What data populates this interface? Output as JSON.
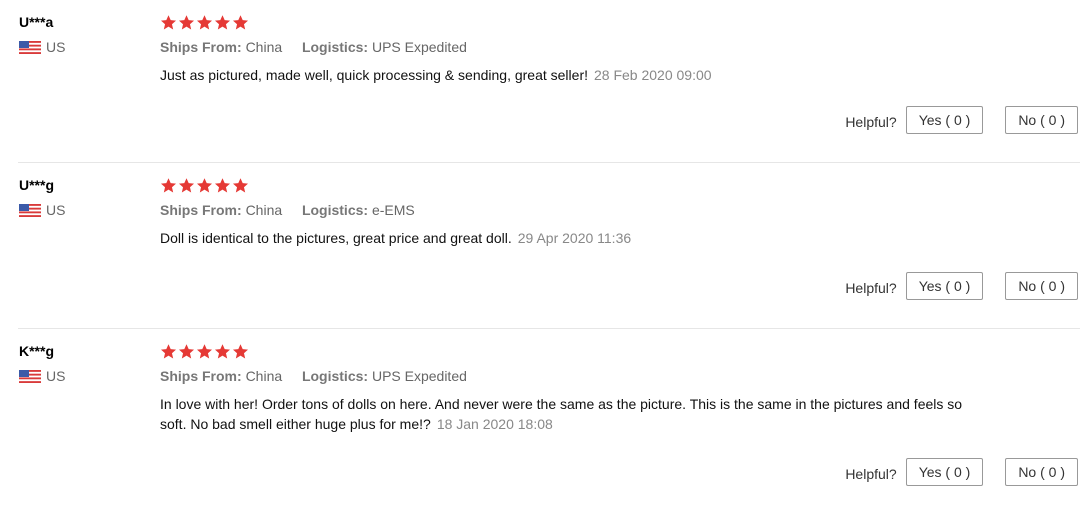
{
  "colors": {
    "star": "#e53935",
    "divider": "#e6e6e6",
    "meta_text": "#666666",
    "date_text": "#888888"
  },
  "icons": {
    "rating": "star-icon",
    "country": "us-flag-icon"
  },
  "helpful": {
    "label": "Helpful?",
    "yes_label": "Yes ( 0 )",
    "no_label": "No ( 0 )"
  },
  "meta_labels": {
    "ships_from": "Ships From:",
    "logistics": "Logistics:"
  },
  "reviews": [
    {
      "user": "U***a",
      "country": "US",
      "rating": 5,
      "ships_from": "China",
      "logistics": "UPS Expedited",
      "text": "Just as pictured, made well, quick processing & sending, great seller!",
      "date": "28 Feb 2020 09:00",
      "yes_label": "Yes ( 0 )",
      "no_label": "No ( 0 )"
    },
    {
      "user": "U***g",
      "country": "US",
      "rating": 5,
      "ships_from": "China",
      "logistics": "e-EMS",
      "text": "Doll is identical to the pictures, great price and great doll.",
      "date": "29 Apr 2020 11:36",
      "yes_label": "Yes ( 0 )",
      "no_label": "No ( 0 )"
    },
    {
      "user": "K***g",
      "country": "US",
      "rating": 5,
      "ships_from": "China",
      "logistics": "UPS Expedited",
      "text": "In love with her! Order tons of dolls on here. And never were the same as the picture. This is the same in the pictures and feels so soft. No bad smell either huge plus for me!?",
      "date": "18 Jan 2020 18:08",
      "yes_label": "Yes ( 0 )",
      "no_label": "No ( 0 )"
    }
  ]
}
